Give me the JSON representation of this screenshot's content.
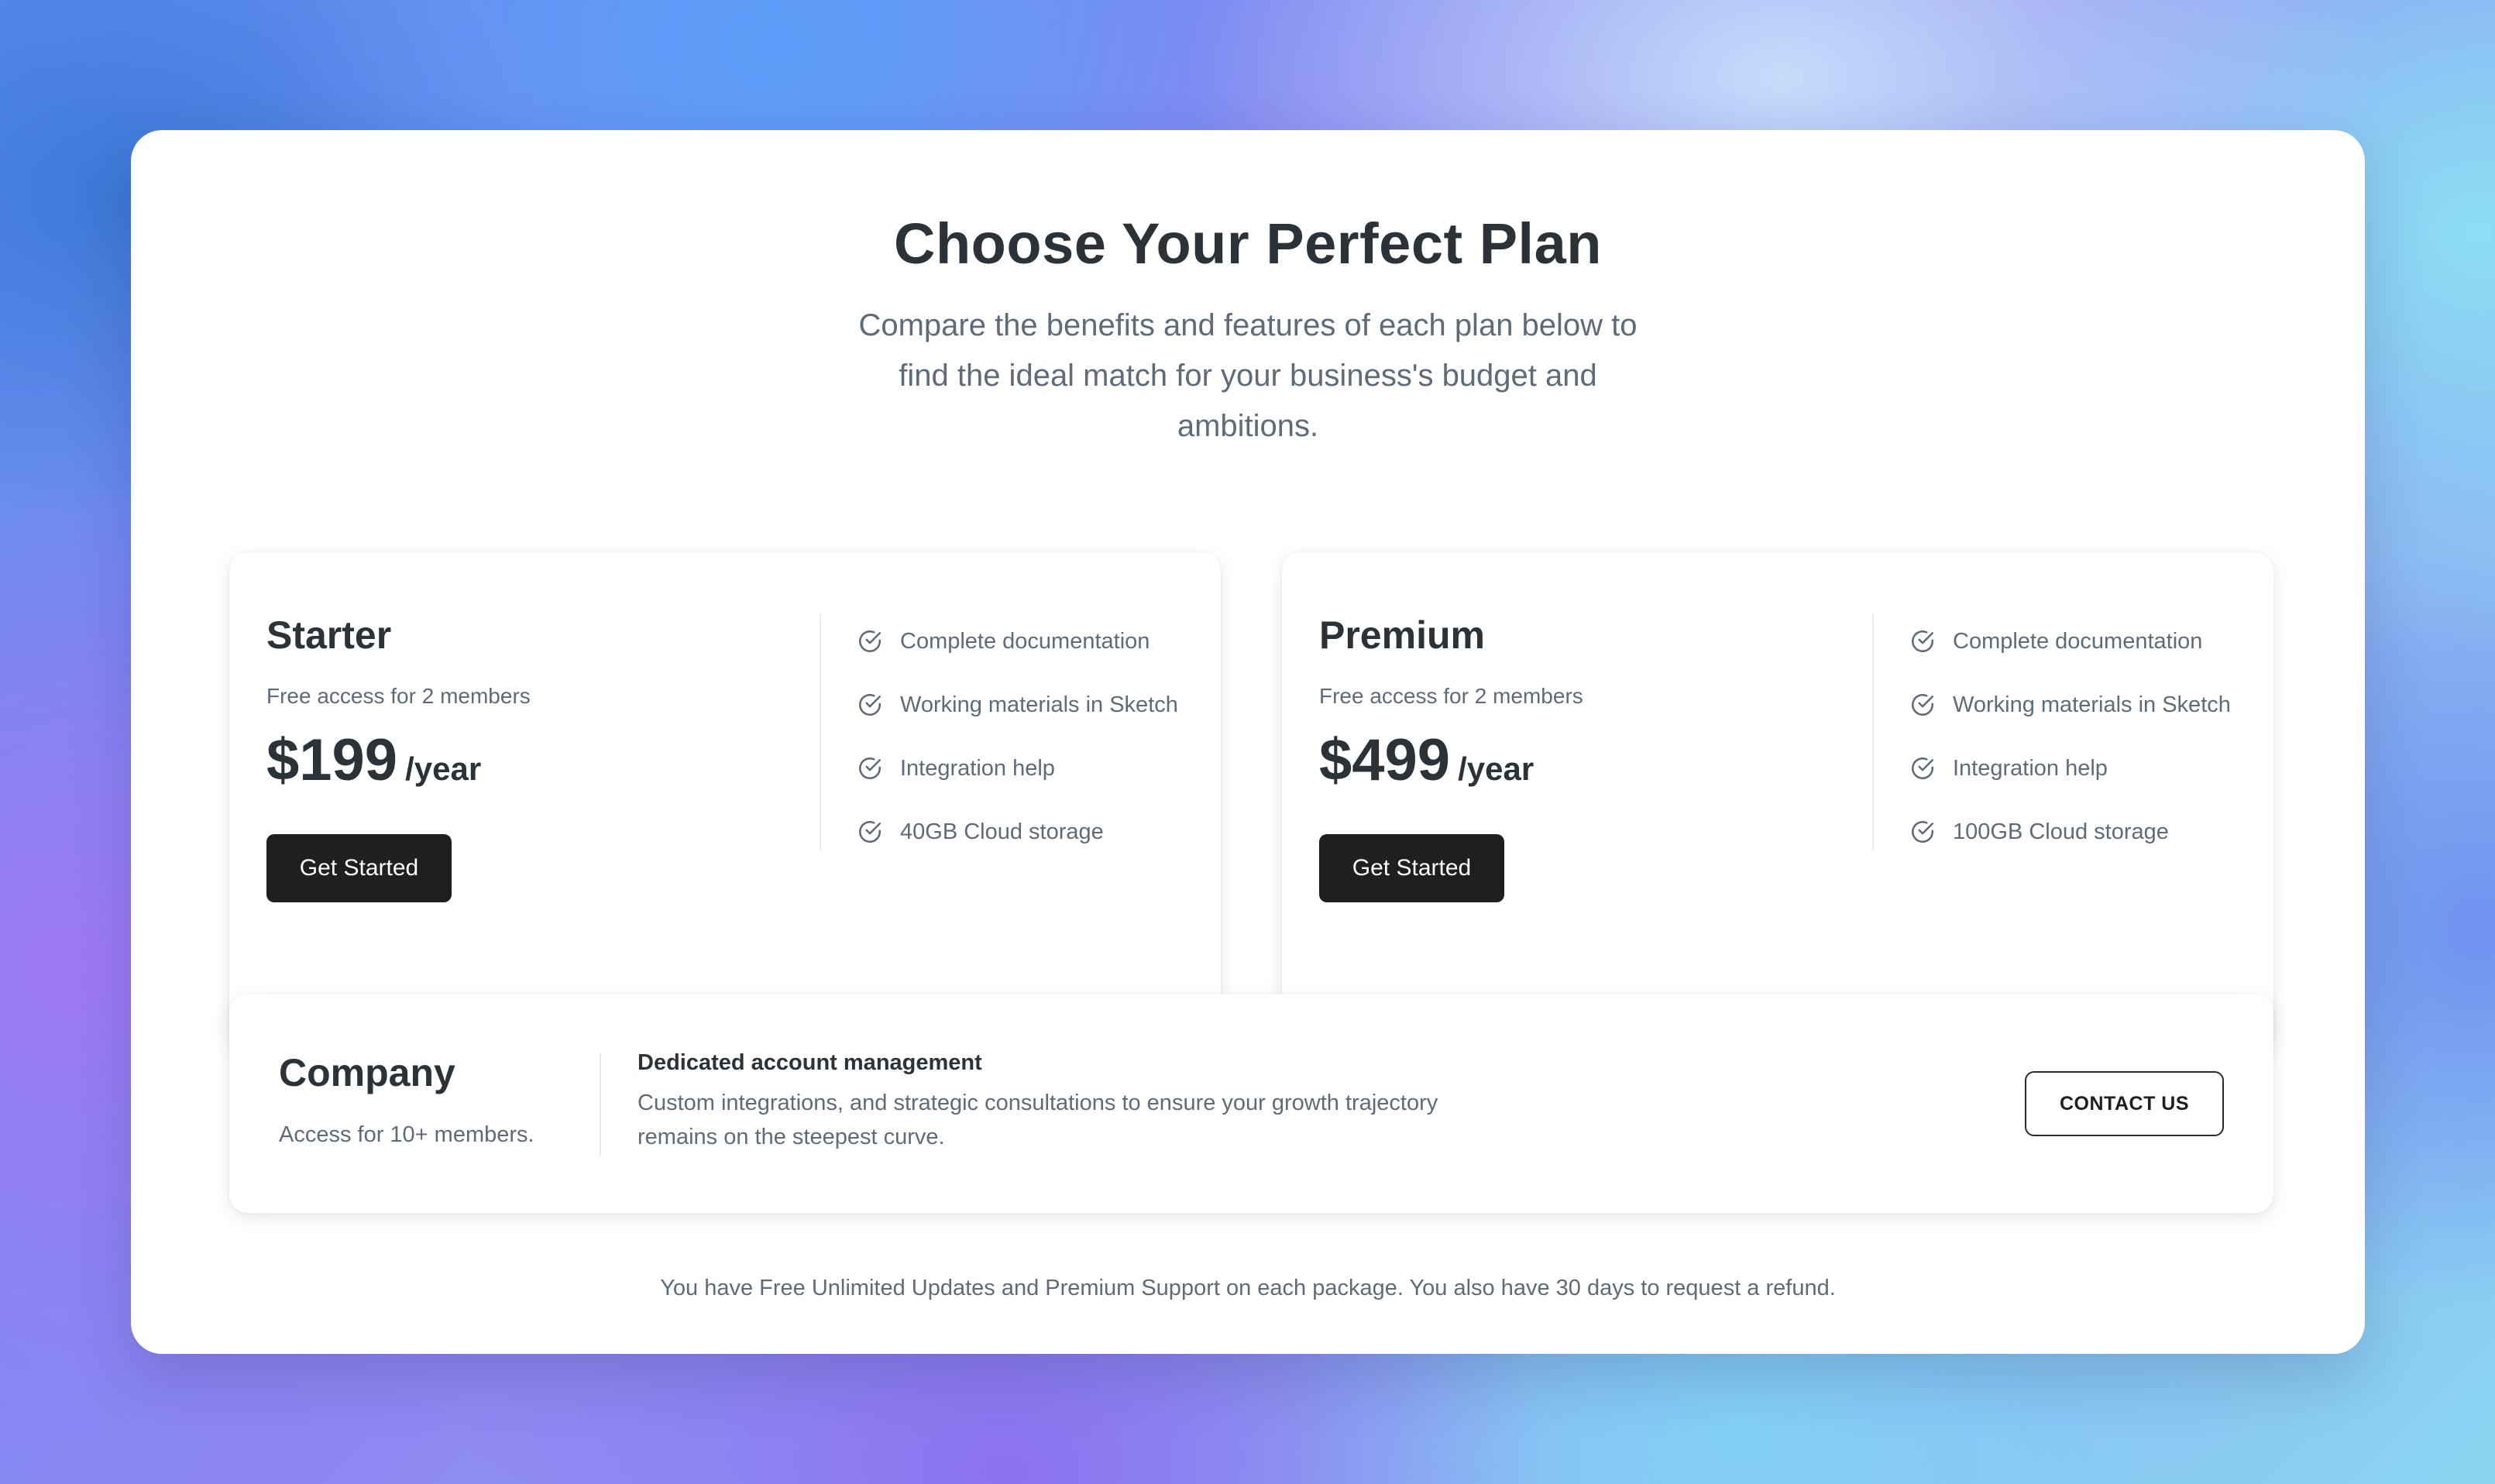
{
  "header": {
    "title": "Choose Your Perfect Plan",
    "subtitle": "Compare the benefits and features of each plan below to find the ideal match for your business's budget and ambitions."
  },
  "plans": [
    {
      "name": "Starter",
      "description": "Free access for 2 members",
      "price": "$199",
      "period": "/year",
      "cta": "Get Started",
      "features": [
        "Complete documentation",
        "Working materials in Sketch",
        "Integration help",
        "40GB Cloud storage"
      ]
    },
    {
      "name": "Premium",
      "description": "Free access for 2 members",
      "price": "$499",
      "period": "/year",
      "cta": "Get Started",
      "features": [
        "Complete documentation",
        "Working materials in Sketch",
        "Integration help",
        "100GB Cloud storage"
      ]
    }
  ],
  "company": {
    "name": "Company",
    "description": "Access for 10+ members.",
    "feature_title": "Dedicated account management",
    "feature_description": "Custom integrations, and strategic consultations to ensure your growth trajectory remains on the steepest curve.",
    "cta": "CONTACT US"
  },
  "footer": {
    "note": "You have Free Unlimited Updates and Premium Support on each package. You also have 30 days to request a refund."
  },
  "icons": {
    "feature_check": "check-circle-icon"
  },
  "colors": {
    "heading": "#2b3338",
    "muted_text": "#5f6b78",
    "primary_button": "#1f1f1f",
    "panel": "#ffffff"
  }
}
